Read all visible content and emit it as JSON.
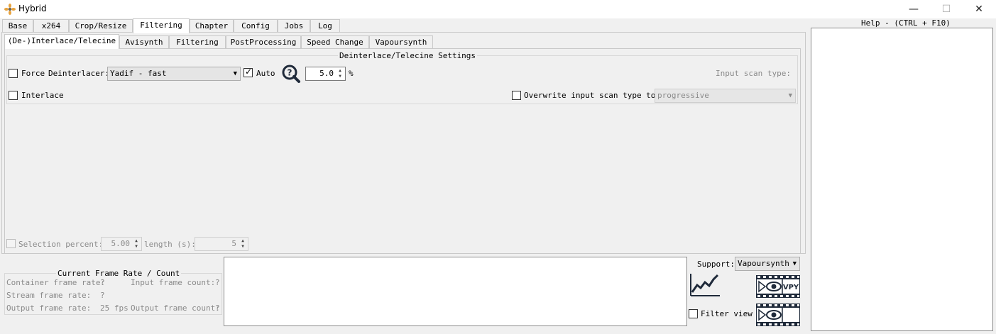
{
  "window": {
    "title": "Hybrid",
    "minimize": "—",
    "maximize": "☐",
    "close": "✕"
  },
  "main_tabs": [
    "Base",
    "x264",
    "Crop/Resize",
    "Filtering",
    "Chapter",
    "Config",
    "Jobs",
    "Log"
  ],
  "main_tab_active": "Filtering",
  "sub_tabs": [
    "(De-)Interlace/Telecine",
    "Avisynth",
    "Filtering",
    "PostProcessing",
    "Speed Change",
    "Vapoursynth"
  ],
  "sub_tab_active": "(De-)Interlace/Telecine",
  "deinterlace": {
    "group_title": "Deinterlace/Telecine Settings",
    "force_label": "Force",
    "force_checked": false,
    "deinterlacer_label": "Deinterlacer:",
    "deinterlacer_value": "Yadif - fast",
    "auto_label": "Auto",
    "auto_checked": true,
    "percent_value": "5.0",
    "percent_unit": "%",
    "input_scan_label": "Input scan type:",
    "interlace_label": "Interlace",
    "interlace_checked": false,
    "overwrite_label": "Overwrite input scan type to:",
    "overwrite_checked": false,
    "overwrite_value": "progressive"
  },
  "selection": {
    "selection_label": "Selection percent:",
    "selection_value": "5.00",
    "length_label": "length (s):",
    "length_value": "5"
  },
  "frame_rate": {
    "title": "Current Frame Rate / Count",
    "container_label": "Container frame rate:",
    "container_value": "?",
    "input_count_label": "Input frame count:",
    "input_count_value": "?",
    "stream_label": "Stream frame rate:",
    "stream_value": "?",
    "output_label": "Output frame rate:",
    "output_value": "25 fps",
    "output_count_label": "Output frame count:",
    "output_count_value": "?"
  },
  "support": {
    "label": "Support:",
    "value": "Vapoursynth",
    "filter_view_label": "Filter view",
    "filter_view_checked": false,
    "vpy_label": "VPY"
  },
  "help": {
    "title": "Help - (CTRL + F10)"
  },
  "colors": {
    "window_bg": "#f0f0f0",
    "border": "#c9c9c9",
    "icon_blue": "#1f2a3a"
  },
  "icons": [
    "app-icon",
    "zoom-icon",
    "graph-icon",
    "preview-vpy-icon",
    "preview-icon"
  ]
}
